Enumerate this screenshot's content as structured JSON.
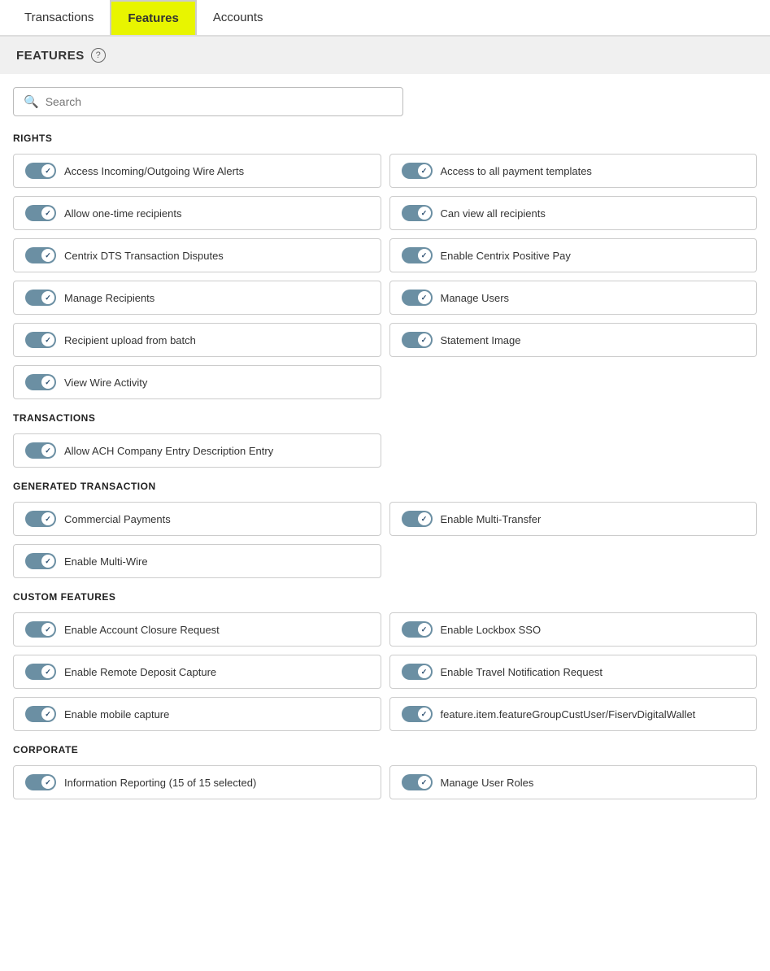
{
  "tabs": [
    {
      "label": "Transactions",
      "active": false
    },
    {
      "label": "Features",
      "active": true
    },
    {
      "label": "Accounts",
      "active": false
    }
  ],
  "section": {
    "title": "FEATURES",
    "help": "?"
  },
  "search": {
    "placeholder": "Search"
  },
  "groups": [
    {
      "label": "RIGHTS",
      "items": [
        {
          "label": "Access Incoming/Outgoing Wire Alerts",
          "enabled": true
        },
        {
          "label": "Access to all payment templates",
          "enabled": true
        },
        {
          "label": "Allow one-time recipients",
          "enabled": true
        },
        {
          "label": "Can view all recipients",
          "enabled": true
        },
        {
          "label": "Centrix DTS Transaction Disputes",
          "enabled": true
        },
        {
          "label": "Enable Centrix Positive Pay",
          "enabled": true
        },
        {
          "label": "Manage Recipients",
          "enabled": true
        },
        {
          "label": "Manage Users",
          "enabled": true
        },
        {
          "label": "Recipient upload from batch",
          "enabled": true
        },
        {
          "label": "Statement Image",
          "enabled": true
        },
        {
          "label": "View Wire Activity",
          "enabled": true
        }
      ]
    },
    {
      "label": "TRANSACTIONS",
      "items": [
        {
          "label": "Allow ACH Company Entry Description Entry",
          "enabled": true
        }
      ]
    },
    {
      "label": "GENERATED TRANSACTION",
      "items": [
        {
          "label": "Commercial Payments",
          "enabled": true
        },
        {
          "label": "Enable Multi-Transfer",
          "enabled": true
        },
        {
          "label": "Enable Multi-Wire",
          "enabled": true
        }
      ]
    },
    {
      "label": "CUSTOM FEATURES",
      "items": [
        {
          "label": "Enable Account Closure Request",
          "enabled": true
        },
        {
          "label": "Enable Lockbox SSO",
          "enabled": true
        },
        {
          "label": "Enable Remote Deposit Capture",
          "enabled": true
        },
        {
          "label": "Enable Travel Notification Request",
          "enabled": true
        },
        {
          "label": "Enable mobile capture",
          "enabled": true
        },
        {
          "label": "feature.item.featureGroupCustUser/FiservDigitalWallet",
          "enabled": true
        }
      ]
    },
    {
      "label": "CORPORATE",
      "items": [
        {
          "label": "Information Reporting (15 of 15 selected)",
          "enabled": true
        },
        {
          "label": "Manage User Roles",
          "enabled": true
        }
      ]
    }
  ]
}
